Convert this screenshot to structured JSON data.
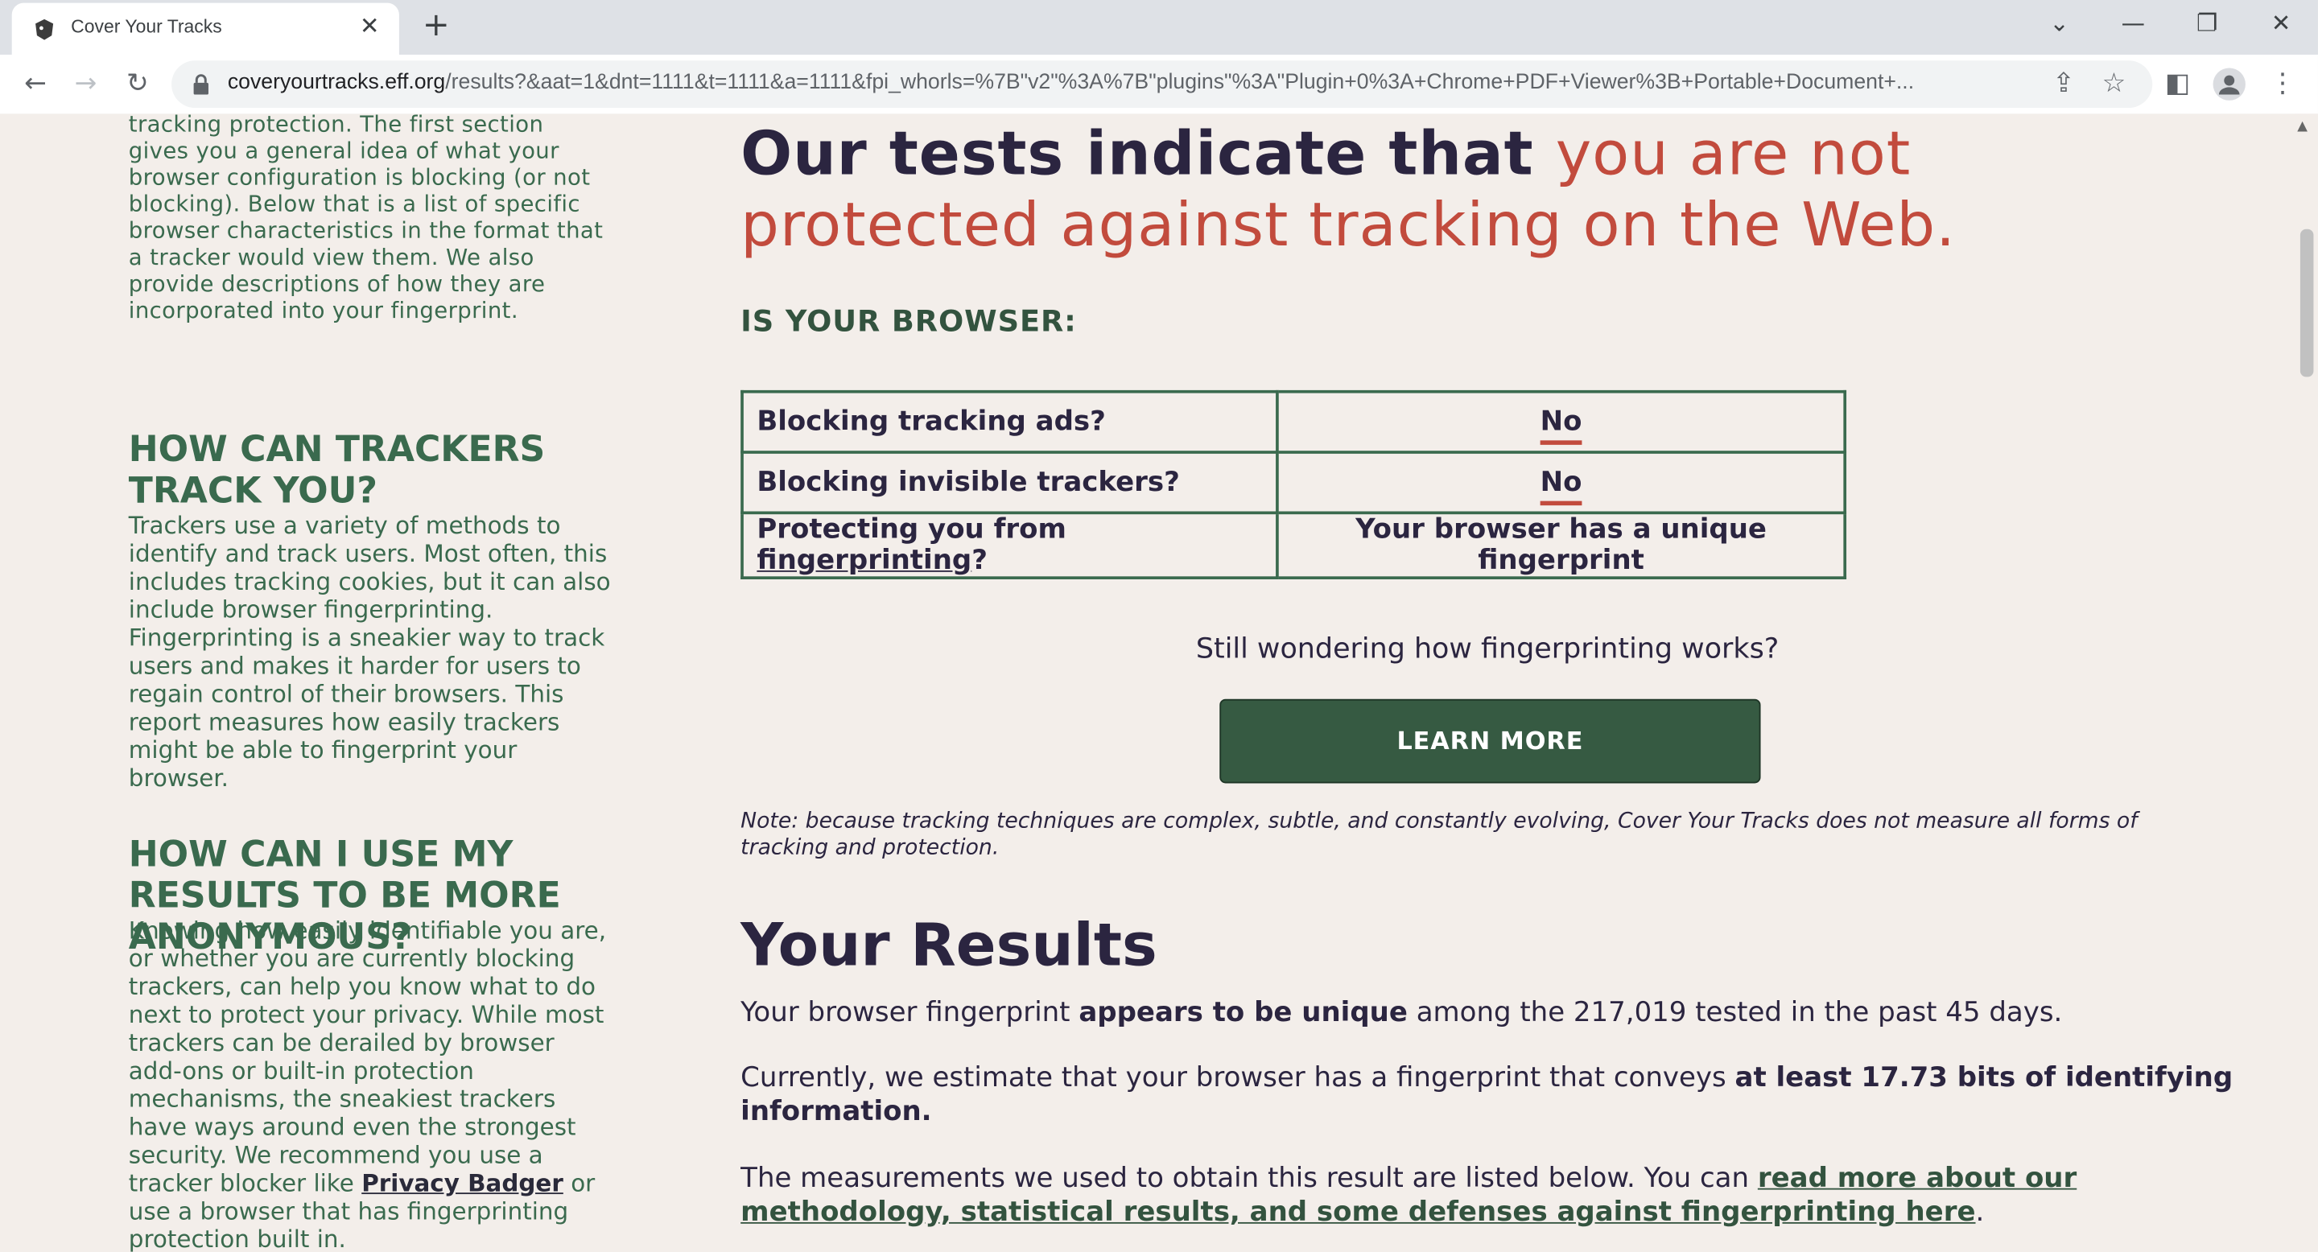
{
  "browser": {
    "tab_title": "Cover Your Tracks",
    "url_host": "coveryourtracks.eff.org",
    "url_path": "/results?&aat=1&dnt=1111&t=1111&a=1111&fpi_whorls=%7B\"v2\"%3A%7B\"plugins\"%3A\"Plugin+0%3A+Chrome+PDF+Viewer%3B+Portable+Document+..."
  },
  "sidebar": {
    "intro_text": "tracking protection. The first section gives you a general idea of what your browser configuration is blocking (or not blocking). Below that is a list of specific browser characteristics in the format that a tracker would view them. We also provide descriptions of how they are incorporated into your fingerprint.",
    "section1_heading": "HOW CAN TRACKERS TRACK YOU?",
    "section1_text": "Trackers use a variety of methods to identify and track users. Most often, this includes tracking cookies, but it can also include browser fingerprinting. Fingerprinting is a sneakier way to track users and makes it harder for users to regain control of their browsers. This report measures how easily trackers might be able to fingerprint your browser.",
    "section2_heading": "HOW CAN I USE MY RESULTS TO BE MORE ANONYMOUS?",
    "section2_text_a": "Knowing how easily identifiable you are, or whether you are currently blocking trackers, can help you know what to do next to protect your privacy. While most trackers can be derailed by browser add-ons or built-in protection mechanisms, the sneakiest trackers have ways around even the strongest security. We recommend you use a tracker blocker like",
    "section2_link": "Privacy Badger",
    "section2_text_b": "or use a browser that has fingerprinting protection built in."
  },
  "main": {
    "headline_a": "Our tests indicate that",
    "headline_b": "you are not protected against tracking on the Web.",
    "is_your_browser": "IS YOUR BROWSER:",
    "rows": [
      {
        "question": "Blocking tracking ads?",
        "answer": "No"
      },
      {
        "question": "Blocking invisible trackers?",
        "answer": "No"
      },
      {
        "question_a": "Protecting you from",
        "question_link": "fingerprinting",
        "question_b": "?",
        "answer": "Your browser has a unique fingerprint"
      }
    ],
    "wondering": "Still wondering how fingerprinting works?",
    "learn_more": "LEARN MORE",
    "note": "Note: because tracking techniques are complex, subtle, and constantly evolving, Cover Your Tracks does not measure all forms of tracking and protection.",
    "results_heading": "Your Results",
    "result1_a": "Your browser fingerprint",
    "result1_b": "appears to be unique",
    "result1_c": "among the 217,019 tested in the past 45 days.",
    "result2_a": "Currently, we estimate that your browser has a fingerprint that conveys",
    "result2_b": "at least 17.73 bits of identifying information.",
    "result3_a": "The measurements we used to obtain this result are listed below. You can",
    "result3_link": "read more about our methodology, statistical results, and some defenses against fingerprinting here",
    "result3_b": "."
  }
}
